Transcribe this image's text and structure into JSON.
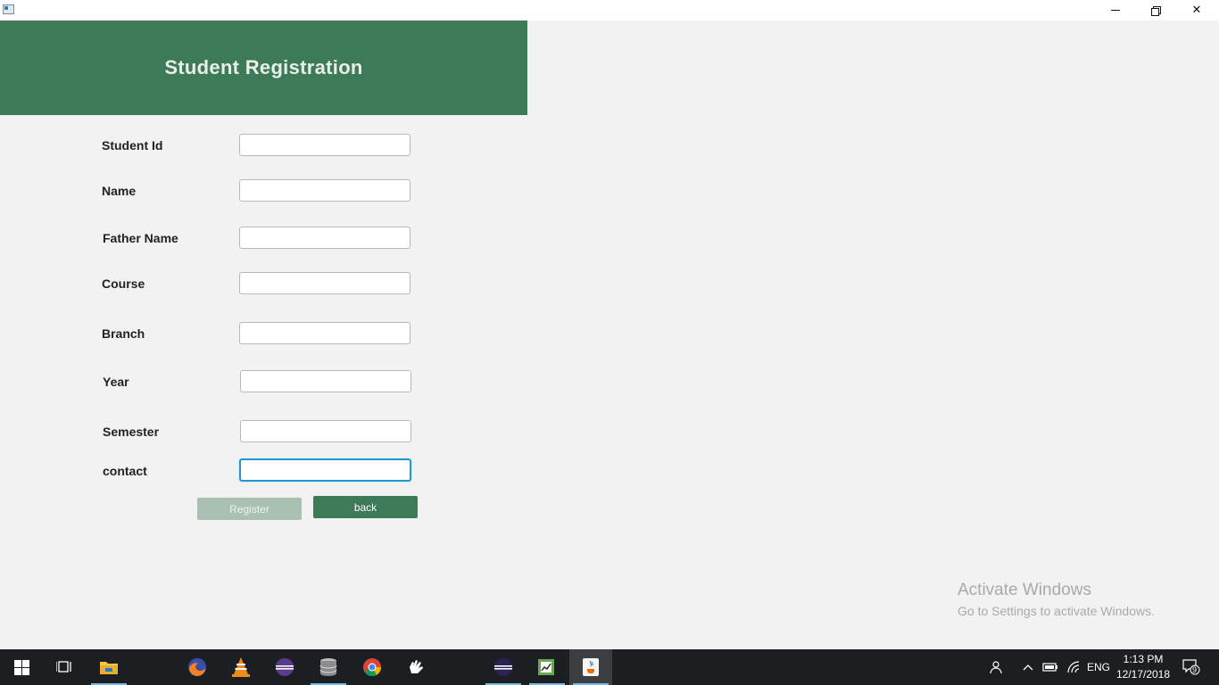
{
  "window": {
    "minimize_glyph": "",
    "close_glyph": "✕"
  },
  "header": {
    "title": "Student Registration"
  },
  "form": {
    "fields": [
      {
        "label": "Student Id",
        "value": ""
      },
      {
        "label": "Name",
        "value": ""
      },
      {
        "label": "Father Name",
        "value": ""
      },
      {
        "label": "Course",
        "value": ""
      },
      {
        "label": "Branch",
        "value": ""
      },
      {
        "label": "Year",
        "value": ""
      },
      {
        "label": "Semester",
        "value": ""
      },
      {
        "label": "contact",
        "value": ""
      }
    ],
    "register_label": "Register",
    "back_label": "back"
  },
  "watermark": {
    "line1": "Activate Windows",
    "line2": "Go to Settings to activate Windows."
  },
  "taskbar": {
    "apps": [
      "windows-start",
      "task-view",
      "file-explorer",
      "firefox",
      "vlc",
      "eclipse",
      "database",
      "chrome",
      "hand-tool",
      "eclipse-2",
      "editor",
      "java"
    ],
    "language": "ENG",
    "time": "1:13 PM",
    "date": "12/17/2018",
    "notification_count": "9"
  },
  "colors": {
    "accent": "#3d7a58",
    "register_disabled": "#a9c1b3",
    "focus_border": "#1a9ad6"
  }
}
